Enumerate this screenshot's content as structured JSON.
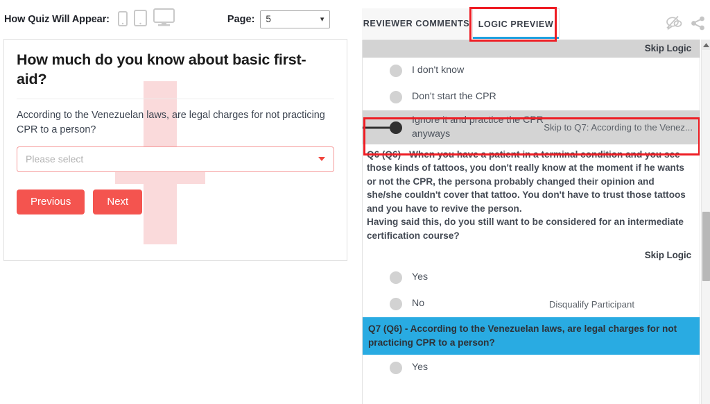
{
  "left": {
    "preview_label": "How Quiz Will Appear:",
    "devices": [
      {
        "name": "mobile-preview-icon",
        "label": "Mobile"
      },
      {
        "name": "tablet-preview-icon",
        "label": "Tablet"
      },
      {
        "name": "desktop-preview-icon",
        "label": "Desktop"
      }
    ],
    "page_label": "Page:",
    "page_value": "5",
    "chevron": "⌄",
    "quiz": {
      "title": "How much do you know about basic first-aid?",
      "question": "According to the Venezuelan laws, are legal charges for not practicing CPR to a person?",
      "select_placeholder": "Please select",
      "previous_label": "Previous",
      "next_label": "Next"
    }
  },
  "right": {
    "tabs": [
      {
        "label": "REVIEWER COMMENTS",
        "active": false
      },
      {
        "label": "LOGIC PREVIEW",
        "active": true
      }
    ],
    "icons": [
      {
        "name": "comments-off-icon"
      },
      {
        "name": "share-icon"
      }
    ],
    "blocks": {
      "skip_logic_header_1": "Skip Logic",
      "options_q5": [
        {
          "label": "I don't know",
          "action": ""
        },
        {
          "label": "Don't start the CPR",
          "action": ""
        },
        {
          "label": "Ignore it and practice the CPR anyways",
          "action": "Skip to Q7: According to the Venez..."
        }
      ],
      "q6_text": "Q6 (Q6) - When you have a patient in a terminal condition and you see those kinds of tattoos, you don't really know at the moment if he wants or not the CPR, the persona probably changed their opinion and she/she couldn't cover that tattoo. You don't have to trust those tattoos and you have to revive the person.\nHaving said this, do you still want to be considered for an intermediate certification course?",
      "skip_logic_header_2": "Skip Logic",
      "options_q6": [
        {
          "label": "Yes",
          "action": ""
        },
        {
          "label": "No",
          "action": "Disqualify Participant"
        }
      ],
      "q7_text": "Q7 (Q6) - According to the Venezuelan laws, are legal charges for not practicing CPR to a person?",
      "options_q7": [
        {
          "label": "Yes",
          "action": ""
        }
      ]
    }
  },
  "colors": {
    "accent_red": "#f4544f",
    "highlight_red": "#ee1d24",
    "active_blue": "#29abe2",
    "tab_underline": "#1fa2e0",
    "section_grey": "#d3d3d3",
    "watermark_pink": "#fadadb"
  }
}
